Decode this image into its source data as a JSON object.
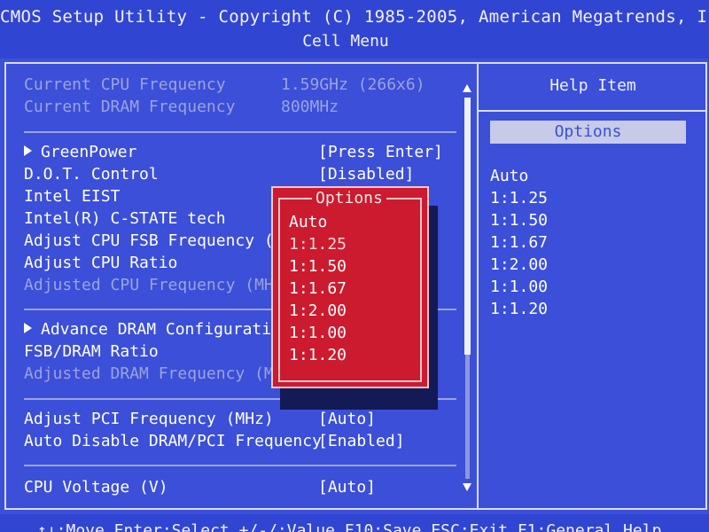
{
  "header": {
    "title": "CMOS Setup Utility - Copyright (C) 1985-2005, American Megatrends, Inc.",
    "menu": "Cell Menu"
  },
  "main": {
    "info": [
      {
        "label": "Current CPU Frequency",
        "value": "1.59GHz (266x6)"
      },
      {
        "label": "Current DRAM Frequency",
        "value": "800MHz"
      }
    ],
    "items": [
      {
        "label": "GreenPower",
        "value": "[Press Enter]"
      },
      {
        "label": "D.O.T. Control",
        "value": "[Disabled]"
      },
      {
        "label": "Intel EIST",
        "value": ""
      },
      {
        "label": "Intel(R) C-STATE tech",
        "value": ""
      },
      {
        "label": "Adjust CPU FSB Frequency (MH",
        "value": ""
      },
      {
        "label": "Adjust CPU Ratio",
        "value": ""
      },
      {
        "label": "Adjusted CPU Frequency (MHz)",
        "value": ""
      },
      {
        "label": "Advance DRAM Configuration",
        "value": ""
      },
      {
        "label": "FSB/DRAM Ratio",
        "value": ""
      },
      {
        "label": "Adjusted DRAM Frequency (MHz",
        "value": ""
      },
      {
        "label": "Adjust PCI Frequency (MHz)",
        "value": "[Auto]"
      },
      {
        "label": "Auto Disable DRAM/PCI Frequency",
        "value": "[Enabled]"
      },
      {
        "label": "CPU Voltage (V)",
        "value": "[Auto]"
      }
    ]
  },
  "help": {
    "title": "Help Item",
    "options_label": "Options",
    "options": [
      "Auto",
      "1:1.25",
      "1:1.50",
      "1:1.67",
      "1:2.00",
      "1:1.00",
      "1:1.20"
    ]
  },
  "popup": {
    "title": "Options",
    "options": [
      "Auto",
      "1:1.25",
      "1:1.50",
      "1:1.67",
      "1:2.00",
      "1:1.00",
      "1:1.20"
    ],
    "selected_index": 1
  },
  "footer": {
    "text": "↑↓:Move  Enter:Select  +/-/:Value  F10:Save  ESC:Exit  F1:General Help"
  },
  "colors": {
    "background": "#3b4fd8",
    "popup": "#cc1a2e",
    "dim_text": "#9aa3e0"
  }
}
